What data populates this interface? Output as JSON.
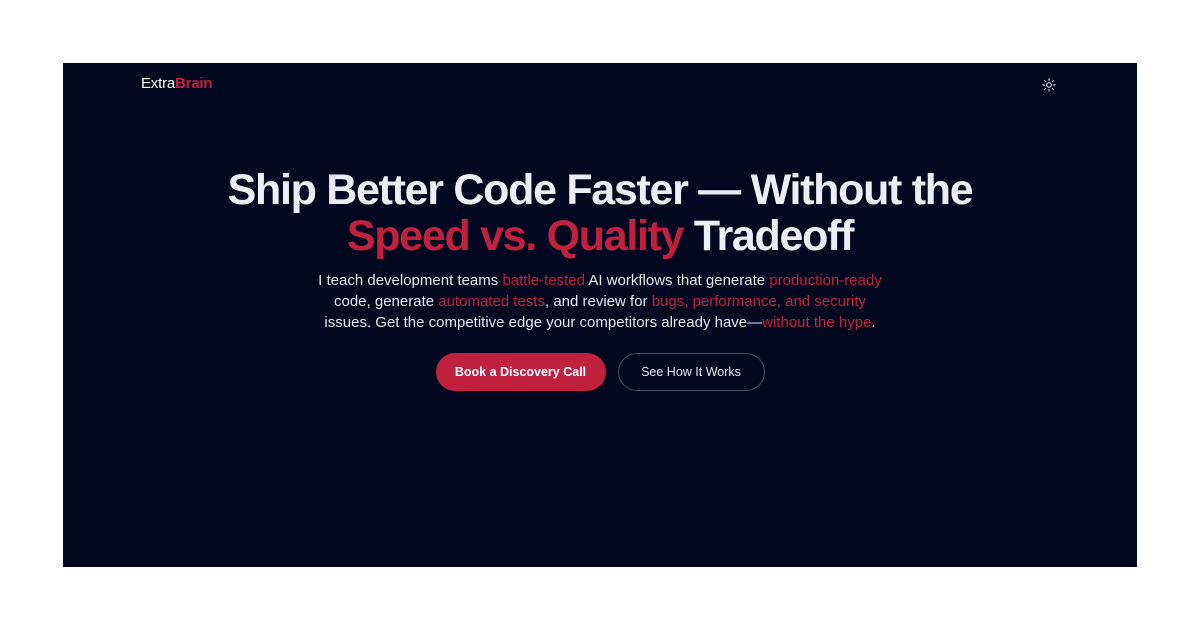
{
  "brand": {
    "name_part1": "Extra",
    "name_part2": "Brain",
    "accent_color": "#c0213f",
    "background_color": "#040720"
  },
  "header": {
    "theme_toggle_icon": "sun-icon"
  },
  "hero": {
    "headline": {
      "line1": "Ship Better Code Faster — Without the",
      "accent": "Speed vs. Quality",
      "tail": " Tradeoff"
    },
    "subtitle": {
      "p1": "I teach development teams ",
      "h1": "battle-tested",
      "p2": " AI workflows that generate ",
      "h2": "production-ready",
      "p3": " code, generate ",
      "h3": "automated tests",
      "p4": ", and review for ",
      "h4": "bugs, performance, and security",
      "p5": " issues. Get the competitive edge your competitors already have—",
      "h5": "without the hype",
      "p6": "."
    },
    "cta_primary": "Book a Discovery Call",
    "cta_secondary": "See How It Works"
  }
}
